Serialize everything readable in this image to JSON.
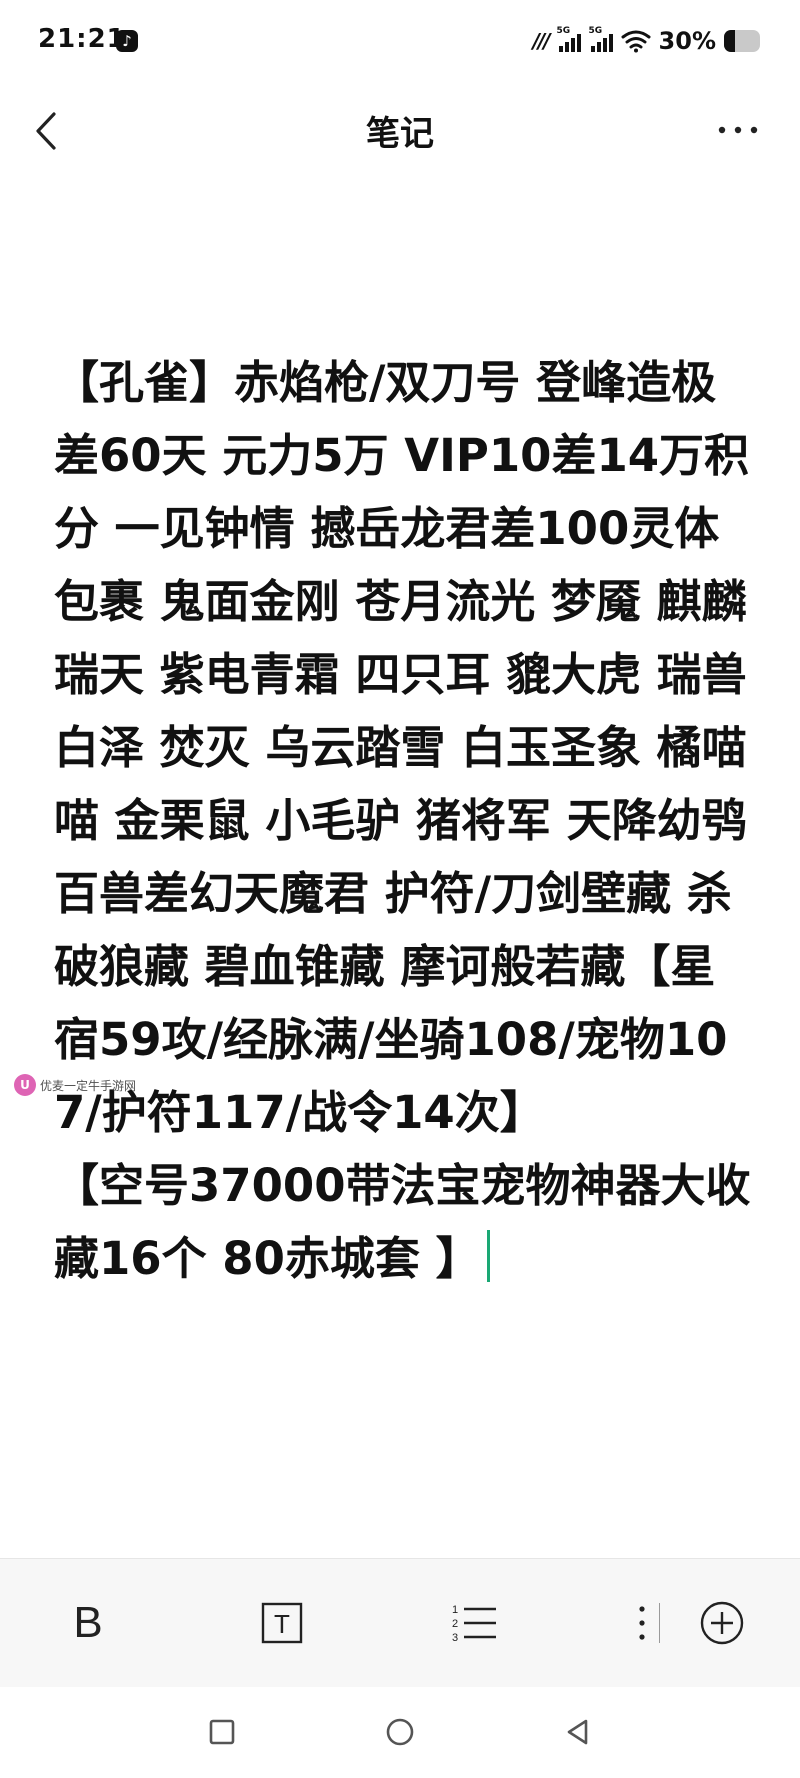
{
  "status_bar": {
    "time": "21:21",
    "signal_1_label": "5G",
    "signal_2_label": "5G",
    "battery_percent": "30%",
    "battery_level": 0.3
  },
  "header": {
    "title": "笔记"
  },
  "note": {
    "paragraph_1": "【孔雀】赤焰枪/双刀号 登峰造极差60天 元力5万 VIP10差14万积分 一见钟情 撼岳龙君差100灵体包裹 鬼面金刚 苍月流光 梦魇 麒麟瑞天 紫电青霜 四只耳 貔大虎 瑞兽白泽 焚灭 乌云踏雪 白玉圣象 橘喵喵 金栗鼠 小毛驴 猪将军 天降幼鸮 百兽差幻天魔君 护符/刀剑壁藏 杀破狼藏 碧血锥藏 摩诃般若藏【星宿59攻/经脉满/坐骑108/宠物107/护符117/战令14次】",
    "paragraph_2": "【空号37000带法宝宠物神器大收藏16个 80赤城套 】"
  },
  "watermark": {
    "text": "优麦一定牛手游网"
  },
  "toolbar": {
    "bold_label": "B",
    "text_style_label": "T"
  },
  "icons": {
    "back": "chevron-left-icon",
    "more": "more-horizontal-icon",
    "list": "numbered-list-icon",
    "insert": "plus-circle-icon"
  },
  "colors": {
    "caret": "#1aa874",
    "toolbar_bg": "#f7f7f7",
    "text": "#111111"
  }
}
